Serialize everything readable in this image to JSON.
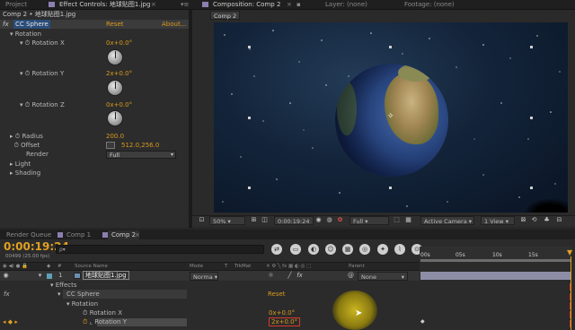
{
  "top_tabs": {
    "project": "Project",
    "effect_controls": "Effect Controls: 地球贴图1.jpg",
    "composition": "Composition: Comp 2",
    "layer": "Layer: (none)",
    "footage": "Footage: (none)"
  },
  "effect_controls": {
    "breadcrumb": "Comp 2 • 地球贴图1.jpg",
    "effect_name": "CC Sphere",
    "reset": "Reset",
    "about": "About...",
    "rotation_group": "Rotation",
    "rotation_x_label": "Rotation X",
    "rotation_x_value": "0x+0.0°",
    "rotation_y_label": "Rotation Y",
    "rotation_y_value": "2x+0.0°",
    "rotation_z_label": "Rotation Z",
    "rotation_z_value": "0x+0.0°",
    "radius_label": "Radius",
    "radius_value": "200.0",
    "offset_label": "Offset",
    "offset_value": "512.0,256.0",
    "render_label": "Render",
    "render_value": "Full",
    "light_label": "Light",
    "shading_label": "Shading"
  },
  "composition": {
    "comp_tab": "Comp 2",
    "zoom": "50%",
    "timecode": "0:00:19:24",
    "resolution": "Full",
    "camera": "Active Camera",
    "views": "1 View"
  },
  "timeline": {
    "tabs": [
      "Render Queue",
      "Comp 1",
      "Comp 2"
    ],
    "timecode": "0:00:19:24",
    "frame_info": "00499 (25.00 fps)",
    "search_placeholder": "ρ▾",
    "columns": {
      "source_name": "Source Name",
      "mode": "Mode",
      "t": "T",
      "trkmat": "TrkMat",
      "parent": "Parent"
    },
    "layer_number": "1",
    "layer_name": "地球贴图1.jpg",
    "layer_mode": "Norma ▾",
    "parent_value": "None",
    "effects_label": "Effects",
    "effect_name": "CC Sphere",
    "effect_reset": "Reset",
    "rotation_group": "Rotation",
    "rotation_x_label": "Rotation X",
    "rotation_x_value": "0x+0.0°",
    "rotation_y_label": "Rotation Y",
    "rotation_y_value": "2x+0.0°",
    "ruler": [
      "00s",
      "05s",
      "10s",
      "15s"
    ],
    "fx_label": "fx"
  },
  "colors": {
    "accent_orange": "#d99a1e",
    "selection_highlight": "#d63a2b",
    "layer_bar": "#8d8ea6"
  }
}
